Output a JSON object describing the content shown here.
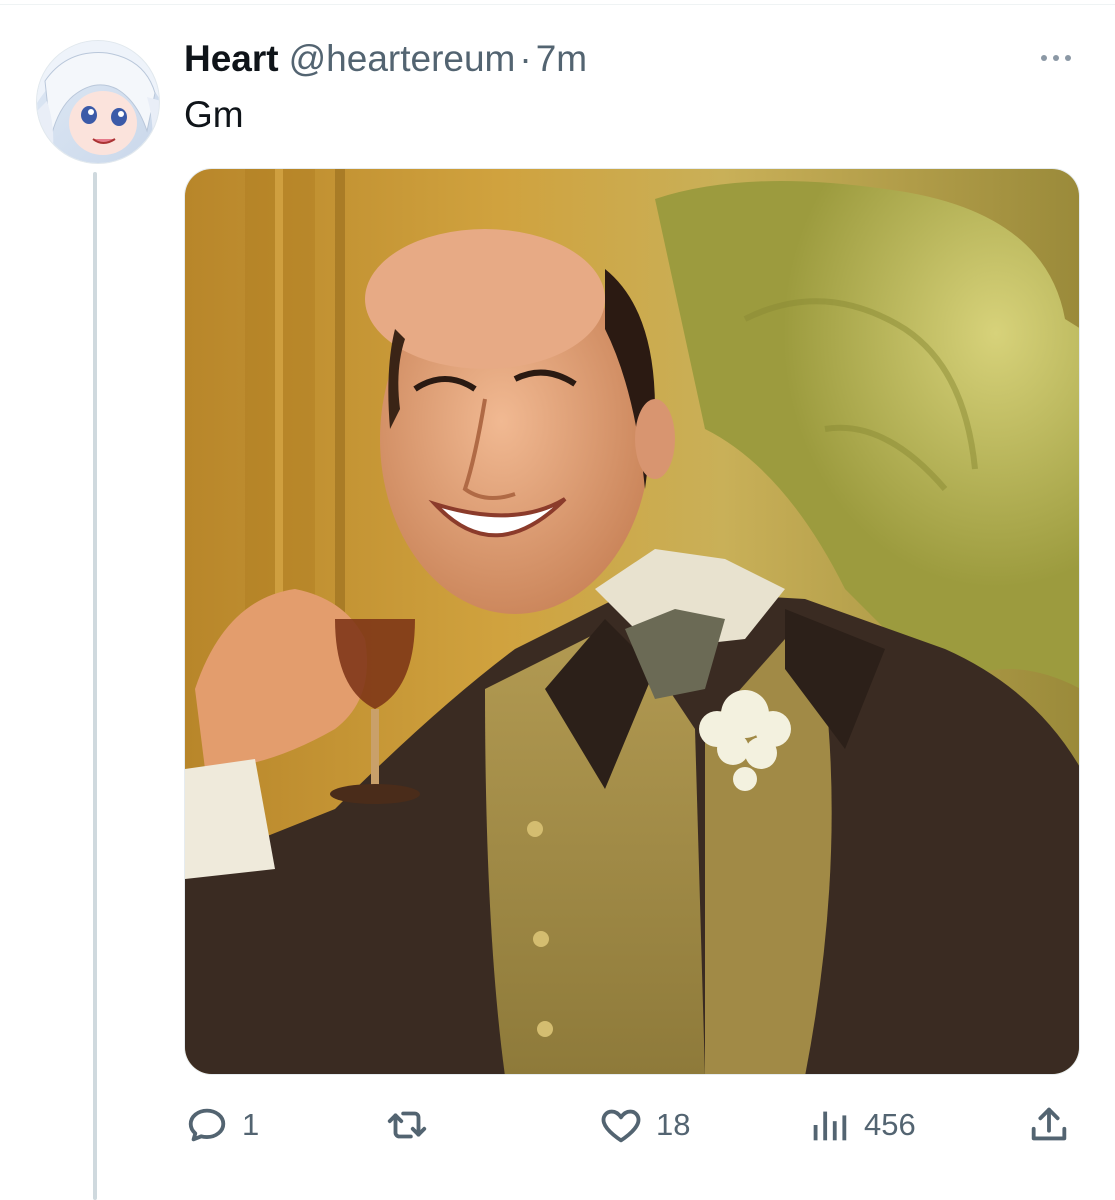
{
  "tweet": {
    "author_name": "Heart",
    "author_handle": "@heartereum",
    "separator": "·",
    "timestamp": "7m",
    "text": "Gm"
  },
  "actions": {
    "reply_count": "1",
    "retweet_count": "",
    "like_count": "18",
    "views_count": "456"
  },
  "icons": {
    "reply": "reply-icon",
    "retweet": "retweet-icon",
    "like": "heart-icon",
    "views": "views-icon",
    "share": "share-icon",
    "more": "more-icon"
  },
  "colors": {
    "text_primary": "#0f1419",
    "text_secondary": "#536471",
    "thread_line": "#cfd9de"
  }
}
